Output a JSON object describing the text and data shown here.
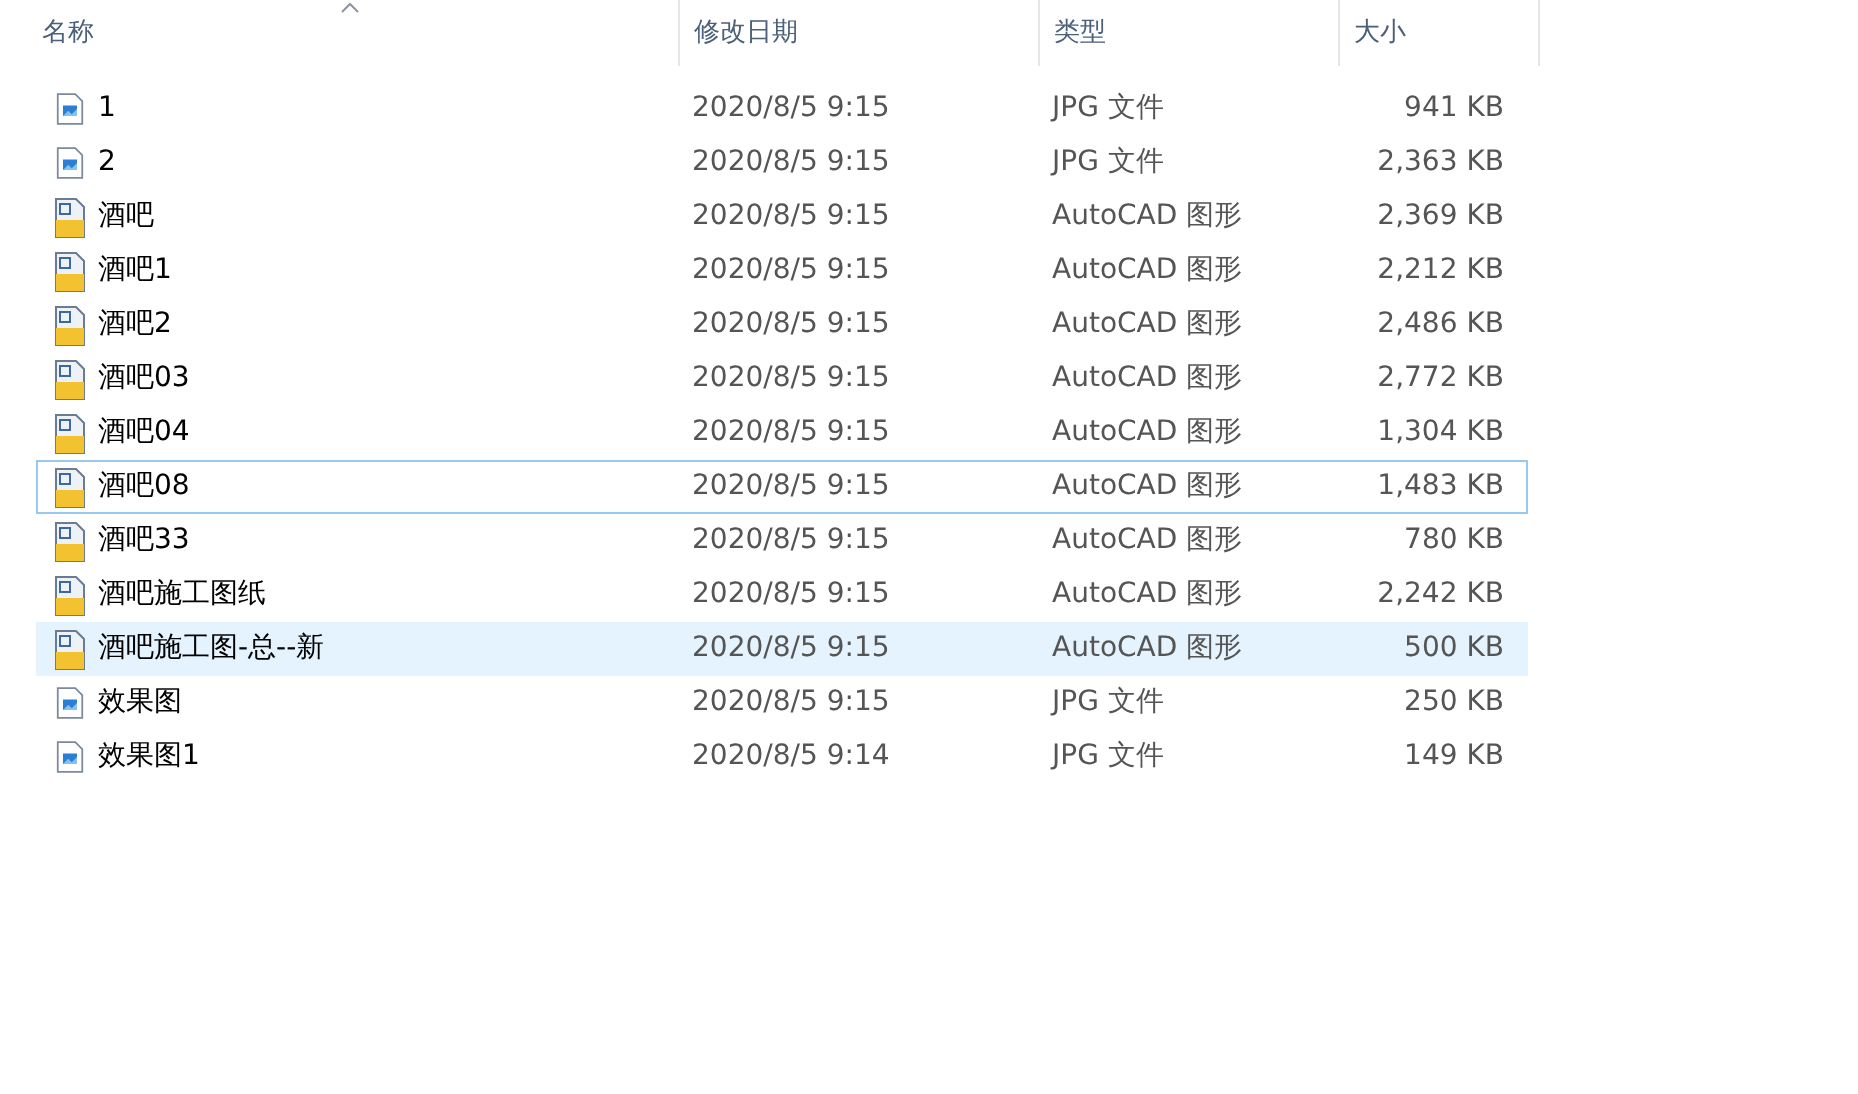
{
  "columns": [
    {
      "label": "名称",
      "sorted": true
    },
    {
      "label": "修改日期",
      "sorted": false
    },
    {
      "label": "类型",
      "sorted": false
    },
    {
      "label": "大小",
      "sorted": false
    }
  ],
  "files": [
    {
      "kind": "jpg",
      "name": "1",
      "modified": "2020/8/5 9:15",
      "type": "JPG 文件",
      "size": "941 KB",
      "selected": false,
      "focused": false
    },
    {
      "kind": "jpg",
      "name": "2",
      "modified": "2020/8/5 9:15",
      "type": "JPG 文件",
      "size": "2,363 KB",
      "selected": false,
      "focused": false
    },
    {
      "kind": "dwg",
      "name": "酒吧",
      "modified": "2020/8/5 9:15",
      "type": "AutoCAD 图形",
      "size": "2,369 KB",
      "selected": false,
      "focused": false
    },
    {
      "kind": "dwg",
      "name": "酒吧1",
      "modified": "2020/8/5 9:15",
      "type": "AutoCAD 图形",
      "size": "2,212 KB",
      "selected": false,
      "focused": false
    },
    {
      "kind": "dwg",
      "name": "酒吧2",
      "modified": "2020/8/5 9:15",
      "type": "AutoCAD 图形",
      "size": "2,486 KB",
      "selected": false,
      "focused": false
    },
    {
      "kind": "dwg",
      "name": "酒吧03",
      "modified": "2020/8/5 9:15",
      "type": "AutoCAD 图形",
      "size": "2,772 KB",
      "selected": false,
      "focused": false
    },
    {
      "kind": "dwg",
      "name": "酒吧04",
      "modified": "2020/8/5 9:15",
      "type": "AutoCAD 图形",
      "size": "1,304 KB",
      "selected": false,
      "focused": false
    },
    {
      "kind": "dwg",
      "name": "酒吧08",
      "modified": "2020/8/5 9:15",
      "type": "AutoCAD 图形",
      "size": "1,483 KB",
      "selected": false,
      "focused": true
    },
    {
      "kind": "dwg",
      "name": "酒吧33",
      "modified": "2020/8/5 9:15",
      "type": "AutoCAD 图形",
      "size": "780 KB",
      "selected": false,
      "focused": false
    },
    {
      "kind": "dwg",
      "name": "酒吧施工图纸",
      "modified": "2020/8/5 9:15",
      "type": "AutoCAD 图形",
      "size": "2,242 KB",
      "selected": false,
      "focused": false
    },
    {
      "kind": "dwg",
      "name": "酒吧施工图-总--新",
      "modified": "2020/8/5 9:15",
      "type": "AutoCAD 图形",
      "size": "500 KB",
      "selected": true,
      "focused": false
    },
    {
      "kind": "jpg",
      "name": "效果图",
      "modified": "2020/8/5 9:15",
      "type": "JPG 文件",
      "size": "250 KB",
      "selected": false,
      "focused": false
    },
    {
      "kind": "jpg",
      "name": "效果图1",
      "modified": "2020/8/5 9:14",
      "type": "JPG 文件",
      "size": "149 KB",
      "selected": false,
      "focused": false
    }
  ]
}
